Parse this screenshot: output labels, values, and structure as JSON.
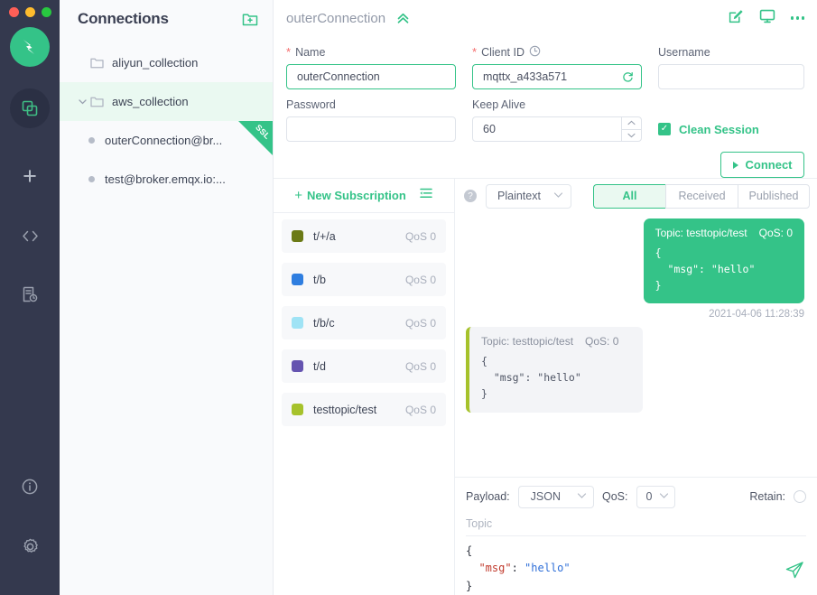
{
  "window": {
    "controls": [
      "close",
      "minimize",
      "maximize"
    ]
  },
  "rail": {
    "logo_icon": "mqttx-logo-icon",
    "items": [
      {
        "icon": "connections-icon",
        "name": "connections",
        "active": true
      },
      {
        "icon": "plus-icon",
        "name": "new-connection",
        "active": false
      },
      {
        "icon": "code-icon",
        "name": "scripts",
        "active": false
      },
      {
        "icon": "log-icon",
        "name": "log",
        "active": false
      },
      {
        "icon": "info-icon",
        "name": "about",
        "active": false
      },
      {
        "icon": "gear-icon",
        "name": "settings",
        "active": false
      }
    ]
  },
  "connections": {
    "title": "Connections",
    "add_icon": "new-folder-icon",
    "tree": [
      {
        "type": "collection",
        "label": "aliyun_collection",
        "selected": false,
        "expanded": false,
        "ssl": false
      },
      {
        "type": "collection",
        "label": "aws_collection",
        "selected": true,
        "expanded": true,
        "ssl": false
      },
      {
        "type": "connection",
        "label": "outerConnection@br...",
        "selected": false,
        "ssl": true,
        "ssl_label": "SSL"
      },
      {
        "type": "connection",
        "label": "test@broker.emqx.io:...",
        "selected": false,
        "ssl": false
      }
    ]
  },
  "header": {
    "title": "outerConnection",
    "collapse_icon": "double-chevron-up-icon",
    "actions": [
      {
        "icon": "edit-icon",
        "name": "edit-connection"
      },
      {
        "icon": "monitor-icon",
        "name": "monitor"
      },
      {
        "icon": "more-icon",
        "name": "more-options"
      }
    ]
  },
  "form": {
    "name": {
      "label": "Name",
      "required": true,
      "value": "outerConnection"
    },
    "client_id": {
      "label": "Client ID",
      "required": true,
      "value": "mqttx_a433a571",
      "suffix_icon": "refresh-icon",
      "label_icon": "clock-icon"
    },
    "username": {
      "label": "Username",
      "required": false,
      "value": "",
      "placeholder": ""
    },
    "password": {
      "label": "Password",
      "required": false,
      "value": "",
      "placeholder": ""
    },
    "keep_alive": {
      "label": "Keep Alive",
      "required": false,
      "value": "60"
    },
    "clean_session": {
      "label": "Clean Session",
      "checked": true
    },
    "connect_button": "Connect"
  },
  "subscriptions": {
    "new_label": "New Subscription",
    "plus": "+",
    "list_icon": "list-settings-icon",
    "items": [
      {
        "topic": "t/+/a",
        "qos": "QoS 0",
        "color": "#6b7a16"
      },
      {
        "topic": "t/b",
        "qos": "QoS 0",
        "color": "#2f7ee0"
      },
      {
        "topic": "t/b/c",
        "qos": "QoS 0",
        "color": "#9fe3f5"
      },
      {
        "topic": "t/d",
        "qos": "QoS 0",
        "color": "#6554b0"
      },
      {
        "topic": "testtopic/test",
        "qos": "QoS 0",
        "color": "#a6c22b"
      }
    ]
  },
  "messages": {
    "help_icon": "question-icon",
    "format": {
      "value": "Plaintext",
      "chevron": "chevron-down-icon"
    },
    "filters": [
      {
        "label": "All",
        "active": true
      },
      {
        "label": "Received",
        "active": false
      },
      {
        "label": "Published",
        "active": false
      }
    ],
    "list": [
      {
        "direction": "published",
        "topic_label": "Topic: testtopic/test",
        "qos_label": "QoS: 0",
        "body": "{\n  \"msg\": \"hello\"\n}",
        "time": "2021-04-06 11:28:39"
      },
      {
        "direction": "received",
        "topic_label": "Topic: testtopic/test",
        "qos_label": "QoS: 0",
        "body": "{\n  \"msg\": \"hello\"\n}",
        "time": ""
      }
    ]
  },
  "publish": {
    "payload_label": "Payload:",
    "payload_value": "JSON",
    "qos_label": "QoS:",
    "qos_value": "0",
    "retain_label": "Retain:",
    "retain_checked": false,
    "topic_placeholder": "Topic",
    "topic_value": "",
    "editor": {
      "line1": "{",
      "key": "\"msg\"",
      "colon": ": ",
      "value": "\"hello\"",
      "line3": "}"
    },
    "send_icon": "send-icon"
  },
  "colors": {
    "accent": "#34c388",
    "rail_bg": "#34394e",
    "panel_bg": "#f9fafc",
    "selected_row": "#eaf9f1"
  }
}
